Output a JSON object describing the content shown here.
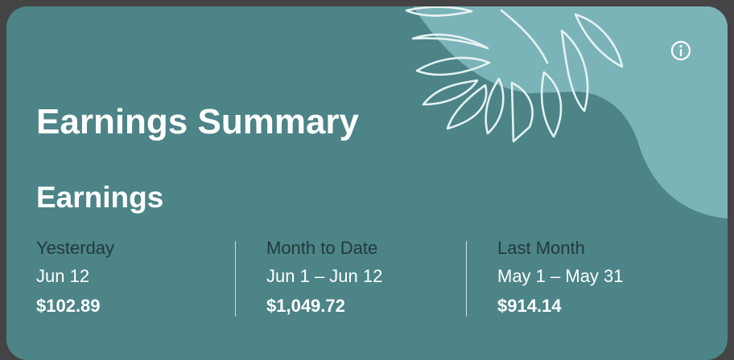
{
  "card": {
    "title": "Earnings Summary",
    "section_title": "Earnings",
    "accent_color": "#4c8488",
    "decor_color": "#7ab4b8",
    "label_color": "#233a3b"
  },
  "icons": {
    "info": "info-circle-icon",
    "decoration": "monstera-leaf-icon"
  },
  "stats": [
    {
      "label": "Yesterday",
      "range": "Jun 12",
      "amount": "$102.89"
    },
    {
      "label": "Month to Date",
      "range": "Jun 1 – Jun 12",
      "amount": "$1,049.72"
    },
    {
      "label": "Last Month",
      "range": "May 1 – May 31",
      "amount": "$914.14"
    }
  ]
}
